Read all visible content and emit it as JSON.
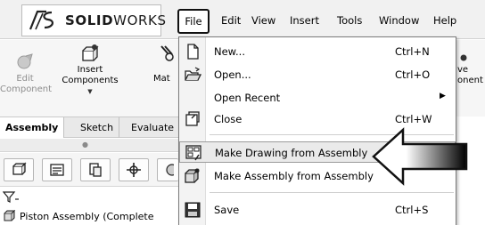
{
  "app": {
    "logo_bold": "SOLID",
    "logo_rest": "WORKS",
    "accent": "#111111"
  },
  "menubar": {
    "items": [
      "File",
      "Edit",
      "View",
      "Insert",
      "Tools",
      "Window",
      "Help"
    ]
  },
  "ribbon": {
    "edit_component": [
      "Edit",
      "Component"
    ],
    "insert_components": [
      "Insert",
      "Components"
    ],
    "mate_partial": "Mat",
    "right_partial": [
      "ve",
      "onent"
    ],
    "dropdown_arrow": "▼"
  },
  "tabs": [
    "Assembly",
    "Sketch",
    "Evaluate"
  ],
  "panel": {
    "collapse_glyph": "●",
    "tree_item": "Piston Assembly (Complete"
  },
  "file_menu": {
    "items": [
      {
        "label": "New...",
        "shortcut": "Ctrl+N",
        "icon": "new-document-icon"
      },
      {
        "label": "Open...",
        "shortcut": "Ctrl+O",
        "icon": "open-folder-icon"
      },
      {
        "label": "Open Recent",
        "shortcut": "",
        "icon": "",
        "submenu": "▶"
      },
      {
        "label": "Close",
        "shortcut": "Ctrl+W",
        "icon": "close-document-icon"
      },
      {
        "label": "Make Drawing from Assembly",
        "shortcut": "",
        "icon": "make-drawing-icon"
      },
      {
        "label": "Make Assembly from Assembly",
        "shortcut": "",
        "icon": "make-assembly-icon"
      },
      {
        "label": "Save",
        "shortcut": "Ctrl+S",
        "icon": "save-icon"
      }
    ]
  }
}
